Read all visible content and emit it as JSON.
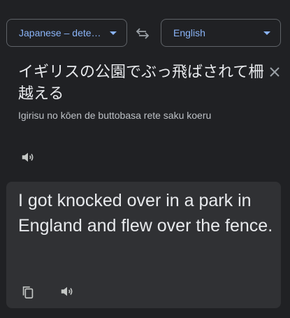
{
  "source_language": {
    "label": "Japanese – dete…",
    "icon": "caret-down-icon"
  },
  "target_language": {
    "label": "English",
    "icon": "caret-down-icon"
  },
  "swap_icon": "swap-arrows-icon",
  "source": {
    "text": "イギリスの公園でぶっ飛ばされて柵越える",
    "romanization": "Igirisu no kōen de buttobasa rete saku koeru",
    "clear_icon": "close-icon",
    "speaker_icon": "speaker-icon"
  },
  "result": {
    "text": "I got knocked over in a park in England and flew over the fence.",
    "copy_icon": "copy-icon",
    "speaker_icon": "speaker-icon"
  },
  "colors": {
    "background": "#202124",
    "card": "#303134",
    "accent": "#8ab4f8",
    "text": "#e8eaed",
    "muted": "#bdc1c6",
    "icon": "#9aa0a6"
  }
}
